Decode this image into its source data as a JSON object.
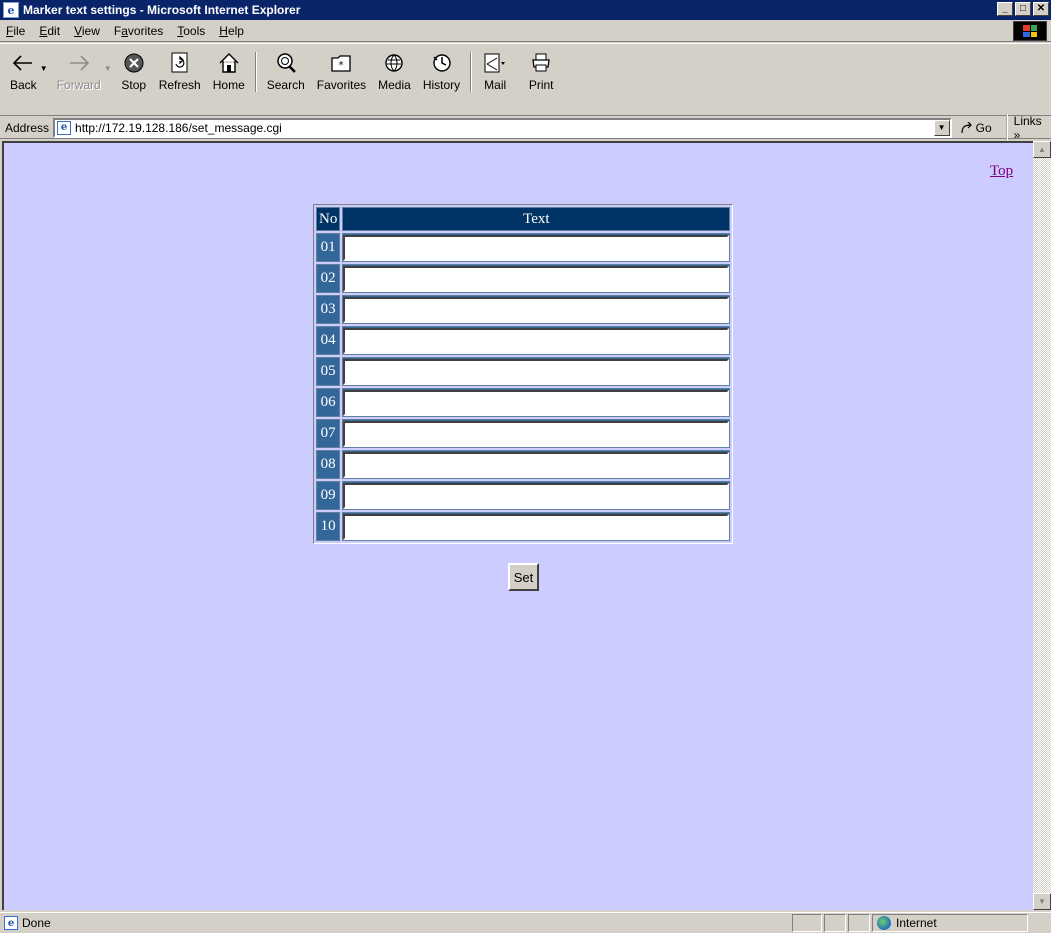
{
  "window": {
    "title": "Marker text settings - Microsoft Internet Explorer"
  },
  "menu": [
    {
      "key": "F",
      "rest": "ile"
    },
    {
      "key": "E",
      "rest": "dit"
    },
    {
      "key": "V",
      "rest": "iew"
    },
    {
      "pre": "F",
      "key": "a",
      "rest": "vorites"
    },
    {
      "key": "T",
      "rest": "ools"
    },
    {
      "key": "H",
      "rest": "elp"
    }
  ],
  "menu_labels": [
    "File",
    "Edit",
    "View",
    "Favorites",
    "Tools",
    "Help"
  ],
  "toolbar": {
    "back": "Back",
    "forward": "Forward",
    "stop": "Stop",
    "refresh": "Refresh",
    "home": "Home",
    "search": "Search",
    "favorites": "Favorites",
    "media": "Media",
    "history": "History",
    "mail": "Mail",
    "print": "Print"
  },
  "address": {
    "label": "Address",
    "url": "http://172.19.128.186/set_message.cgi",
    "go": "Go",
    "links": "Links »"
  },
  "page": {
    "top_link": "Top",
    "table": {
      "header_no": "No",
      "header_text": "Text",
      "rows": [
        {
          "no": "01",
          "value": ""
        },
        {
          "no": "02",
          "value": ""
        },
        {
          "no": "03",
          "value": ""
        },
        {
          "no": "04",
          "value": ""
        },
        {
          "no": "05",
          "value": ""
        },
        {
          "no": "06",
          "value": ""
        },
        {
          "no": "07",
          "value": ""
        },
        {
          "no": "08",
          "value": ""
        },
        {
          "no": "09",
          "value": ""
        },
        {
          "no": "10",
          "value": ""
        }
      ]
    },
    "set_button": "Set"
  },
  "status": {
    "text": "Done",
    "zone": "Internet"
  },
  "colors": {
    "page_background": "#ccccff",
    "table_header": "#003366",
    "row_number_cell": "#336699",
    "visited_link": "#800080",
    "title_bar": "#0a246a"
  },
  "icons": [
    "ie-page-icon",
    "back-arrow-icon",
    "forward-arrow-icon",
    "stop-icon",
    "refresh-icon",
    "home-icon",
    "search-icon",
    "favorites-icon",
    "media-icon",
    "history-icon",
    "mail-icon",
    "print-icon",
    "windows-flag-icon",
    "globe-icon"
  ]
}
